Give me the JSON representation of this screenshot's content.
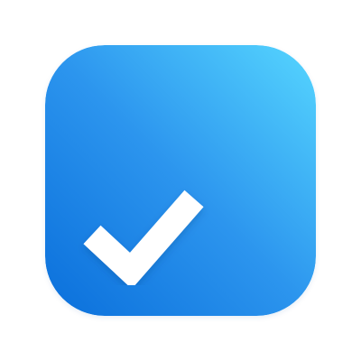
{
  "icon": {
    "semantic": "checkmark-app-icon",
    "glyph": "checkmark",
    "colors": {
      "gradient_start": "#0A6FDB",
      "gradient_mid": "#2C95EE",
      "gradient_end": "#56D6FF",
      "check": "#FFFFFF",
      "background": "#FFFFFF"
    }
  }
}
